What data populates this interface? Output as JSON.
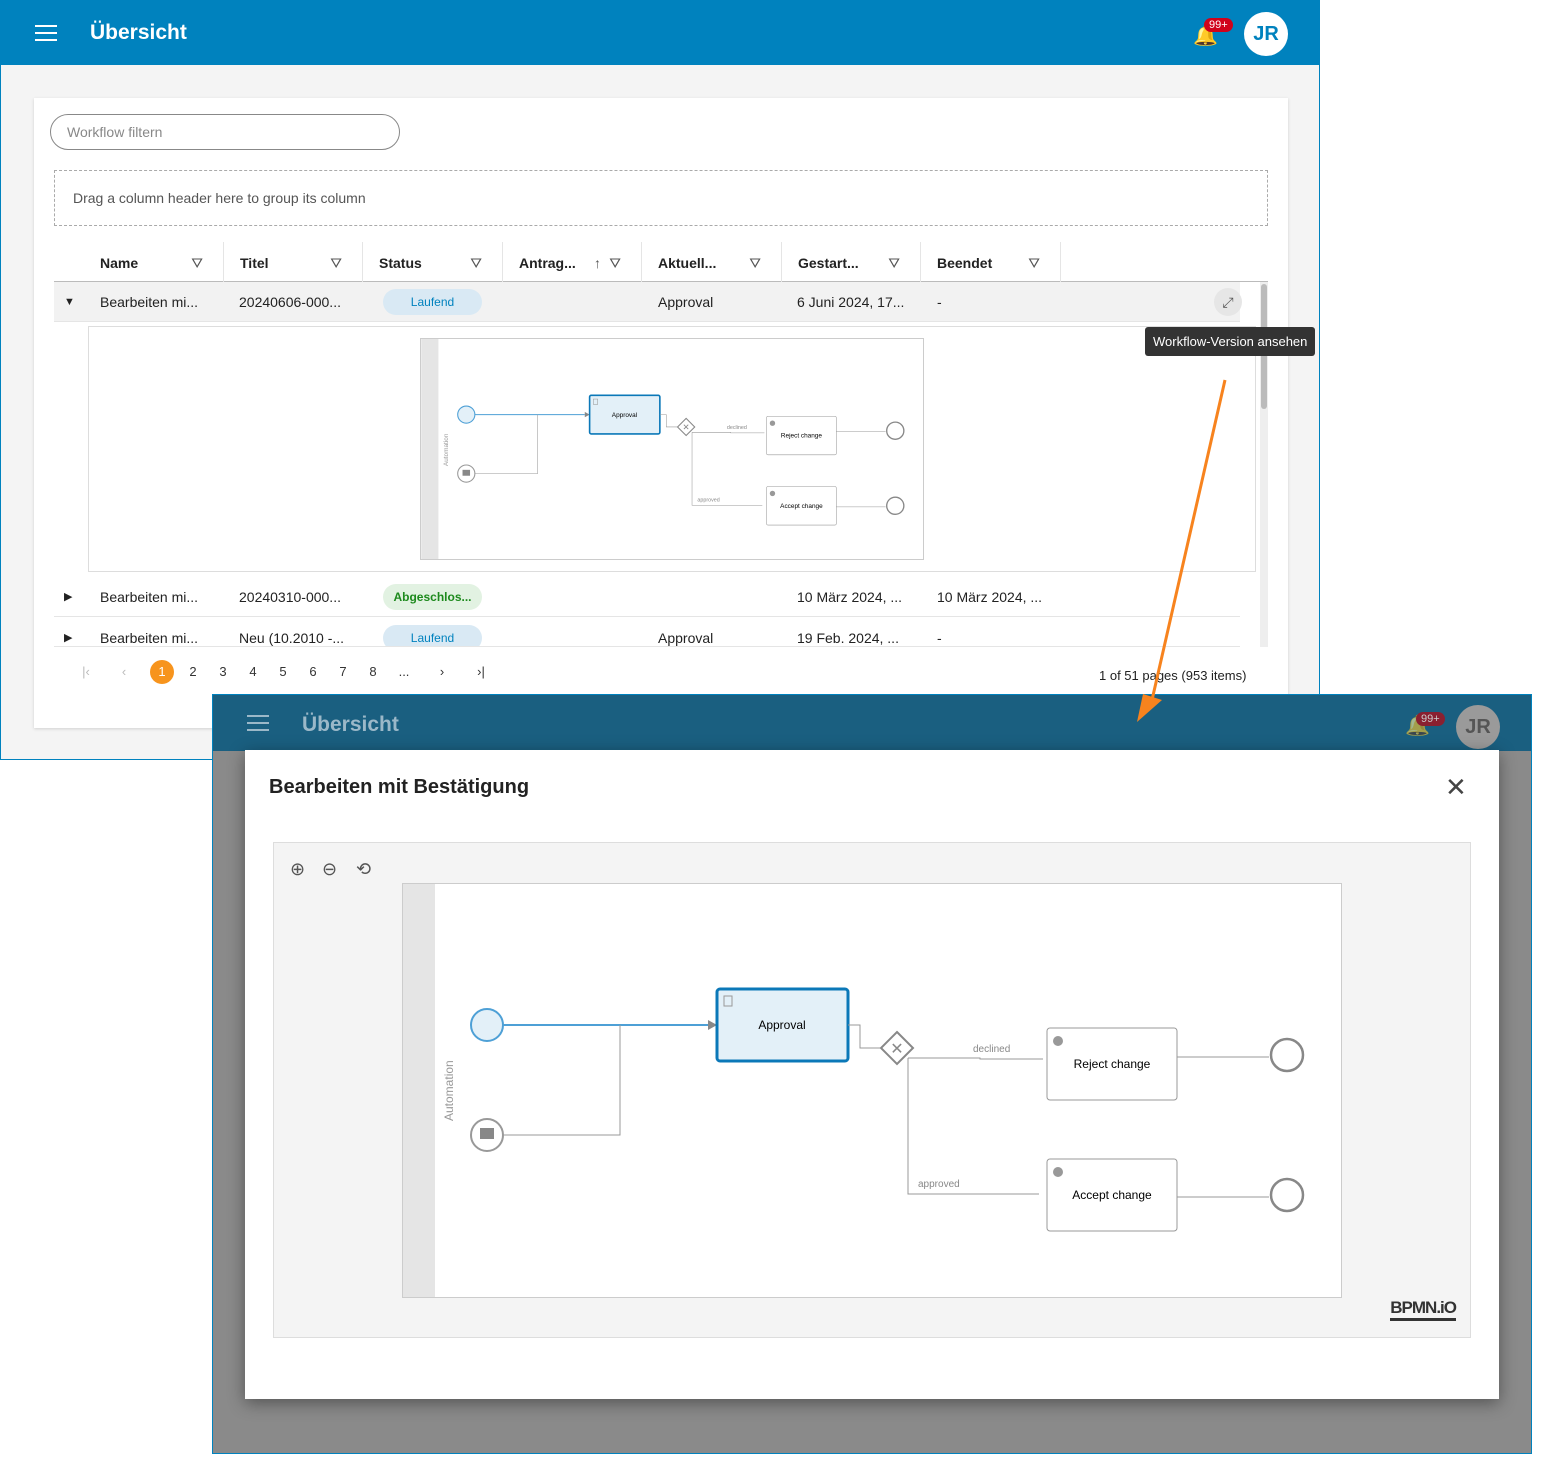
{
  "app": {
    "title": "Übersicht",
    "notification_count": "99+",
    "user_initials": "JR",
    "accent": "#0082be"
  },
  "filter": {
    "placeholder": "Workflow filtern"
  },
  "grid": {
    "group_hint": "Drag a column header here to group its column",
    "columns": [
      "Name",
      "Titel",
      "Status",
      "Antrag...",
      "Aktuell...",
      "Gestart...",
      "Beendet"
    ],
    "sorted_column": "Antrag...",
    "sort_direction": "ascending",
    "rows": [
      {
        "name": "Bearbeiten mi...",
        "titel": "20240606-000...",
        "status": "Laufend",
        "aktuell": "Approval",
        "gestartet": "6 Juni 2024, 17...",
        "beendet": "-",
        "expanded": true
      },
      {
        "name": "Bearbeiten mi...",
        "titel": "20240310-000...",
        "status": "Abgeschlos...",
        "aktuell": "",
        "gestartet": "10 März 2024, ...",
        "beendet": "10 März 2024, ...",
        "expanded": false
      },
      {
        "name": "Bearbeiten mi...",
        "titel": "Neu (10.2010 -...",
        "status": "Laufend",
        "aktuell": "Approval",
        "gestartet": "19 Feb. 2024, ...",
        "beendet": "-",
        "expanded": false
      }
    ],
    "tooltip": "Workflow-Version ansehen"
  },
  "pager": {
    "pages": [
      "1",
      "2",
      "3",
      "4",
      "5",
      "6",
      "7",
      "8",
      "..."
    ],
    "current": "1",
    "summary": "1 of 51 pages (953 items)"
  },
  "modal": {
    "title": "Bearbeiten mit Bestätigung",
    "watermark": "BPMN.iO"
  },
  "diagram": {
    "lane": "Automation",
    "task_approval": "Approval",
    "task_reject": "Reject change",
    "task_accept": "Accept change",
    "flow_declined": "declined",
    "flow_approved": "approved"
  }
}
